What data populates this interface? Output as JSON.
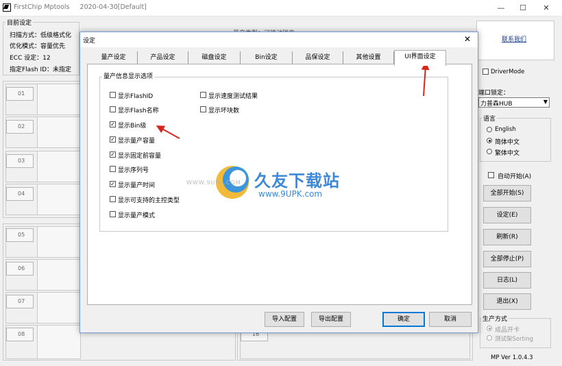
{
  "window": {
    "title": "FirstChip Mptools",
    "title_date": "2020-04-30[Default]",
    "controls": {
      "minimize": "—",
      "maximize": "☐",
      "close": "✕"
    }
  },
  "current_settings": {
    "legend": "目前设定",
    "lines": [
      "扫描方式：低级格式化",
      "优化模式：容量优先",
      "ECC 设定：12",
      "指定Flash ID：未指定"
    ]
  },
  "partial_header_text": "量产类型：可移动磁盘",
  "slots": [
    "01",
    "02",
    "03",
    "04",
    "05",
    "06",
    "07",
    "08",
    "16"
  ],
  "right_panel": {
    "contact": "联系我们",
    "driver_mode": "DriverMode",
    "port_lock_label": "端口锁定：",
    "port_select": "力普森HUB",
    "language_legend": "语言",
    "languages": [
      {
        "label": "English",
        "selected": false
      },
      {
        "label": "简体中文",
        "selected": true
      },
      {
        "label": "繁体中文",
        "selected": false
      }
    ],
    "auto_start": "自动开始(A)",
    "buttons": [
      "全部开始(S)",
      "设定(E)",
      "刷新(R)",
      "全部停止(P)",
      "日志(L)",
      "退出(X)"
    ],
    "mode_legend": "生产方式",
    "modes": [
      {
        "label": "成品开卡",
        "selected": true
      },
      {
        "label": "测试架Sorting",
        "selected": false
      }
    ],
    "version": "MP Ver 1.0.4.3"
  },
  "dialog": {
    "title": "设定",
    "close": "✕",
    "tabs": [
      "量产设定",
      "产品设定",
      "磁盘设定",
      "Bin设定",
      "品保设定",
      "其他设置",
      "UI界面设定"
    ],
    "active_tab": "UI界面设定",
    "group_legend": "量产信息显示选项",
    "options_left": [
      {
        "label": "显示FlashID",
        "checked": false
      },
      {
        "label": "显示Flash名称",
        "checked": false
      },
      {
        "label": "显示Bin级",
        "checked": true
      },
      {
        "label": "显示量产容量",
        "checked": true
      },
      {
        "label": "显示固定前容量",
        "checked": true
      },
      {
        "label": "显示序列号",
        "checked": false
      },
      {
        "label": "显示量产时间",
        "checked": true
      },
      {
        "label": "显示可支持的主控类型",
        "checked": false
      },
      {
        "label": "显示量产模式",
        "checked": false
      }
    ],
    "options_right": [
      {
        "label": "显示速度测试结果",
        "checked": false
      },
      {
        "label": "显示坏块数",
        "checked": false
      }
    ],
    "buttons": {
      "import": "导入配置",
      "export": "导出配置",
      "ok": "确定",
      "cancel": "取消"
    }
  },
  "watermark": {
    "brand": "久友下载站",
    "url": "www.9UPK.com",
    "side": "WWW.9UPK.COM"
  },
  "annotation_color": "#d9261c"
}
